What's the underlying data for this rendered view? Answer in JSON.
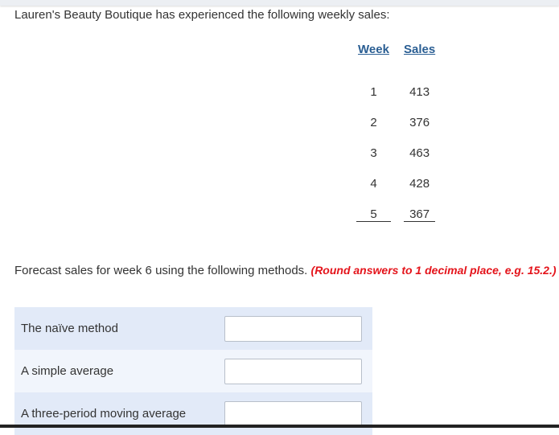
{
  "intro_text": "Lauren's Beauty Boutique has experienced the following weekly sales:",
  "table": {
    "headers": [
      "Week",
      "Sales"
    ],
    "rows": [
      [
        "1",
        "413"
      ],
      [
        "2",
        "376"
      ],
      [
        "3",
        "463"
      ],
      [
        "4",
        "428"
      ],
      [
        "5",
        "367"
      ]
    ]
  },
  "instructions": {
    "text": "Forecast sales for week 6 using the following methods.",
    "note": "(Round answers to 1 decimal place, e.g. 15.2.)"
  },
  "answers": [
    {
      "label": "The naïve method",
      "value": ""
    },
    {
      "label": "A simple average",
      "value": ""
    },
    {
      "label": "A three-period moving average",
      "value": ""
    }
  ]
}
